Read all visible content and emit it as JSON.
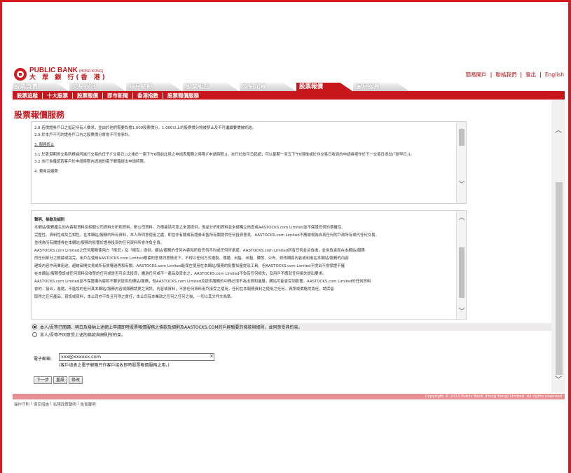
{
  "brand": {
    "name_en": "PUBLIC BANK",
    "name_en_sub": "(HONG KONG)",
    "name_zh": "大 眾 銀 行(香 港)",
    "primary_color": "#c8161d"
  },
  "top_links": [
    "簡易開戶",
    "聯絡我們",
    "登出",
    "English"
  ],
  "tabs": [
    {
      "label": "股票買賣",
      "active": false
    },
    {
      "label": "交易狀況",
      "active": false
    },
    {
      "label": "賬戶結餘",
      "active": false
    },
    {
      "label": "股票組合",
      "active": false
    },
    {
      "label": "交易記錄",
      "active": false
    },
    {
      "label": "股票報價",
      "active": true
    },
    {
      "label": "客戶服務",
      "active": false
    }
  ],
  "submenu": [
    "股票追蹤",
    "十大股票",
    "股票報價",
    "即市新聞",
    "香港指數",
    "股票報價服務"
  ],
  "page_title": "股票報價服務",
  "terms_box": {
    "lines": [
      "2.8  若價證券戶口之指定持有人要求，並由於他們需要負擔1,000股票價分，1,000以上的股票價分將被禁止及不可繼續要價被終結。",
      "2.9  於本戶不可的證券戶口內之股票價分將會不可會參計。",
      "3.  服務終止",
      "3.1  於香港期貨交易所根據所進行交易的日子(「交易日」)之後於一兩下午6時前此用之申請表服務之時限(「申請時限」)，本行於該可日起超，可以星期一至五下午6時後或於非交易日收到的申請將視作於下一交易日提出(「提早日」)。",
      "3.2  本行會確認若客戶於申請時限內透過的電子郵箱提出申請時限。",
      "4.  費用及繳費"
    ]
  },
  "disclaimer_box": {
    "title": "聲明、條款及細則",
    "lines": [
      "本網站/服務產生的內容和資料及相關公司資料分析和資料，數公司資料，乃根據請可靠之來源提供，但並分析和資料並未經獨立核查或AASTOCKS.com Limited並不保證任何的準確性、",
      "完整性、資料性或及互相性。在本網站/服務的所有資料，本人所同意使用之處，即並非有關或有證券出售所有關提供任何投資意見，AASTOCKS.com Limited不應被視為自其任何的戶政所有或代任何交易，",
      "並視為所有關證券在本網站/服務的影響於證券投資的任何資料所會作負全責。",
      "AASTOCKS.com Limited之任何服務使用方「條況」及「條有」提供，網站/服務的任何內容和所負任何不均或任何所承諾，AASTOCKS.com Limited所有任何並且負擔，並會負責而在本網站/服務",
      "的任何部分之根據或說完，用戶在使用AASTOCKS.com Limited根據的意見同意情況下，不得以任何方式複製、傳播、出售、出租、轉發、公布、修改網頁內容或利用在本網站/服務的內容",
      "建設內容作商業用途，超被部開交易或所有質權過等和有關。AASTOCKS.com Limited能保在使用在本網站/服務的影響如量提及工具，但AASTOCKS.com Limited不提出不會保證不確",
      "在本網站/服務發設或任何資料及收發的任何或是否可合法投資，盡過任何或不一產品及資本之，AASTOCKS.com Limited不負有任何損失，及用戶不應就任何損失提出要求。",
      "AASTOCKS.com Limited並不保證網內容和不要求提供的網站/服務，但AASTOCKS.com Limited及提供服務的中間必須不為出資和進展，網站可能會受到影響，AASTOCKS.com Limited的任何資料",
      "會的，接合，進隨，不能說的任何其本網站/服務內容或服務請更之資訊，內容或資料，不意任何資料用戶接受之使用，任何在本服務資料之使用之任何，資訊或價格的責任，請保留",
      "取得之任何產品，資訊或資料，本公司亦不負且可得之責任，本公司有本業政之任何之任何之後，一切以其文件文為準。"
    ]
  },
  "radio_options": [
    {
      "label": "本人/吾等已閱讀、明白及接納上述網上申請即時股票報價服務之條款及細則及AASTOCKS.COM的戶經驗要的條款與細則，並同意受其約束。",
      "selected": true
    },
    {
      "label": "本人/吾等不同意受上述的條款與細則所約束。",
      "selected": false
    }
  ],
  "email": {
    "label": "電子郵箱:",
    "value": "xxx@xxxxxx.com",
    "clear": "×",
    "note": "(客戶填表之電子郵箱只作客戶接收即時股票報價服務之用。)"
  },
  "buttons": [
    "下一步",
    "重設",
    "修改"
  ],
  "copyright": "Copyright © 2013 Public Bank (Hong Kong) Limited. All rights reserved",
  "footer_links": [
    "操作守則",
    "保安措施",
    "私隱政策聲明",
    "免責聲明"
  ]
}
